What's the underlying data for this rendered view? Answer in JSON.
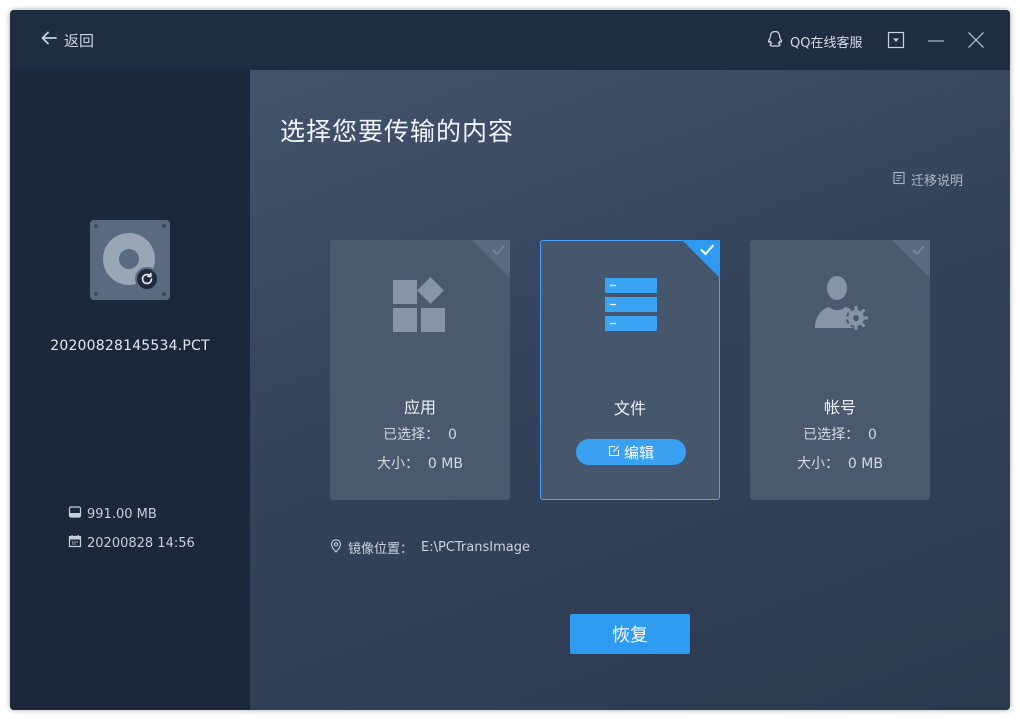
{
  "titlebar": {
    "back_label": "返回",
    "support_label": "QQ在线客服"
  },
  "left_panel": {
    "file_name": "20200828145534.PCT",
    "size": "991.00 MB",
    "date": "20200828 14:56"
  },
  "main": {
    "title": "选择您要传输的内容",
    "guide_label": "迁移说明",
    "cards": [
      {
        "name": "应用",
        "selected_label": "已选择：",
        "selected_count": "0",
        "size_label": "大小：",
        "size_value": "0 MB",
        "checked": false
      },
      {
        "name": "文件",
        "edit_label": "编辑",
        "checked": true
      },
      {
        "name": "帐号",
        "selected_label": "已选择：",
        "selected_count": "0",
        "size_label": "大小：",
        "size_value": "0 MB",
        "checked": false
      }
    ],
    "mirror_label": "镜像位置：",
    "mirror_path": "E:\\PCTransImage",
    "restore_label": "恢复"
  },
  "colors": {
    "accent": "#2f9bf0",
    "sidebar_bg": "#1b283b",
    "titlebar_bg": "#1f2d42"
  }
}
